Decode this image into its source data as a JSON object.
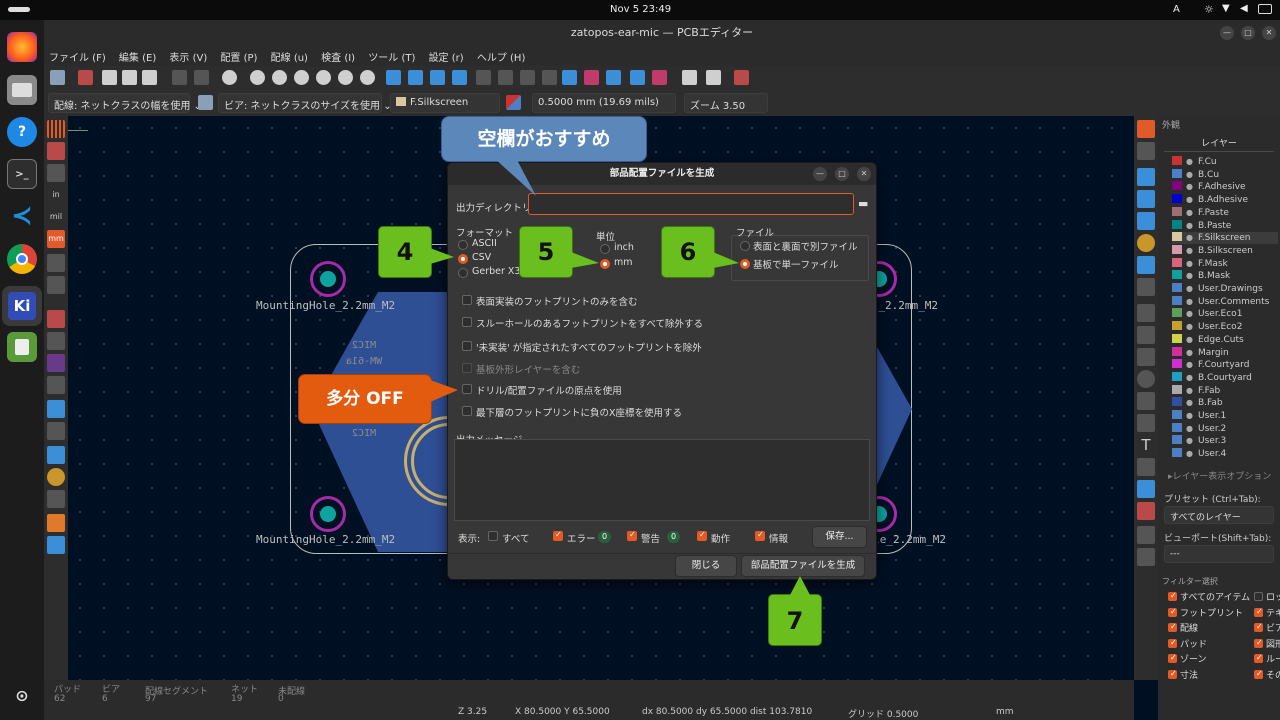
{
  "topbar": {
    "datetime": "Nov 5  23:49",
    "lang": "A"
  },
  "window": {
    "title": "zatopos-ear-mic — PCBエディター"
  },
  "menu": [
    "ファイル (F)",
    "編集 (E)",
    "表示 (V)",
    "配置 (P)",
    "配線 (u)",
    "検査 (I)",
    "ツール (T)",
    "設定 (r)",
    "ヘルプ (H)"
  ],
  "toolbar2": {
    "track_width": "配線: ネットクラスの幅を使用",
    "via_size": "ビア: ネットクラスのサイズを使用",
    "active_layer": "F.Silkscreen",
    "grid": "0.5000 mm (19.69 mils)",
    "zoom": "ズーム 3.50"
  },
  "lefttools": {
    "in": "in",
    "mil": "mil",
    "mm": "mm"
  },
  "board": {
    "ref_label": "MountingHole_2.2mm_M2",
    "mic_label": "MIC2",
    "mic_value": "WM-61a",
    "hole_ref": "REF**"
  },
  "right_panel": {
    "header": "外観",
    "tab_layers": "レイヤー",
    "layers": [
      {
        "name": "F.Cu",
        "color": "#c83434"
      },
      {
        "name": "B.Cu",
        "color": "#4d7fc4"
      },
      {
        "name": "F.Adhesive",
        "color": "#84007c"
      },
      {
        "name": "B.Adhesive",
        "color": "#0000cf"
      },
      {
        "name": "F.Paste",
        "color": "#9a7070"
      },
      {
        "name": "B.Paste",
        "color": "#008484"
      },
      {
        "name": "F.Silkscreen",
        "color": "#d8c8a0"
      },
      {
        "name": "B.Silkscreen",
        "color": "#d898b0"
      },
      {
        "name": "F.Mask",
        "color": "#d8647c"
      },
      {
        "name": "B.Mask",
        "color": "#10a0a0"
      },
      {
        "name": "User.Drawings",
        "color": "#4d7fc4"
      },
      {
        "name": "User.Comments",
        "color": "#4d7fc4"
      },
      {
        "name": "User.Eco1",
        "color": "#5aa05a"
      },
      {
        "name": "User.Eco2",
        "color": "#c4a030"
      },
      {
        "name": "Edge.Cuts",
        "color": "#d0d24a"
      },
      {
        "name": "Margin",
        "color": "#d0309c"
      },
      {
        "name": "F.Courtyard",
        "color": "#d030d0"
      },
      {
        "name": "B.Courtyard",
        "color": "#20a0c0"
      },
      {
        "name": "F.Fab",
        "color": "#aaaaaa"
      },
      {
        "name": "B.Fab",
        "color": "#3050a0"
      },
      {
        "name": "User.1",
        "color": "#4d7fc4"
      },
      {
        "name": "User.2",
        "color": "#4d7fc4"
      },
      {
        "name": "User.3",
        "color": "#4d7fc4"
      },
      {
        "name": "User.4",
        "color": "#4d7fc4"
      }
    ],
    "layer_options": "▸レイヤー表示オプション",
    "preset_label": "プリセット (Ctrl+Tab):",
    "preset_value": "すべてのレイヤー",
    "viewport_label": "ビューポート(Shift+Tab):",
    "viewport_value": "---",
    "filter_label": "フィルター選択",
    "filters_left": [
      "すべてのアイテム",
      "フットプリント",
      "配線",
      "パッド",
      "ゾーン",
      "寸法"
    ],
    "filters_right": [
      "ロッ",
      "テキ",
      "ビア",
      "図形",
      "ルー",
      "その"
    ]
  },
  "statusbar": {
    "pads_label": "パッド",
    "pads": "62",
    "vias_label": "ビア",
    "vias": "6",
    "segments_label": "配線セグメント",
    "segments": "97",
    "nets_label": "ネット",
    "nets": "19",
    "unrouted_label": "未配線",
    "unrouted": "0",
    "z": "Z 3.25",
    "xy": "X 80.5000  Y 65.5000",
    "dxy": "dx 80.5000  dy 65.5000  dist 103.7810",
    "grid": "グリッド 0.5000",
    "units": "mm"
  },
  "dialog": {
    "title": "部品配置ファイルを生成",
    "output_dir_label": "出力ディレクトリ:",
    "output_dir_value": "",
    "format_label": "フォーマット",
    "formats": [
      "ASCII",
      "CSV",
      "Gerber X3"
    ],
    "units_label": "単位",
    "units": [
      "inch",
      "mm"
    ],
    "files_label": "ファイル",
    "files": [
      "表面と裏面で別ファイル",
      "基板で単一ファイル"
    ],
    "options": [
      "表面実装のフットプリントのみを含む",
      "スルーホールのあるフットプリントをすべて除外する",
      "'未実装' が指定されたすべてのフットプリントを除外",
      "基板外形レイヤーを含む",
      "ドリル/配置ファイルの原点を使用",
      "最下層のフットプリントに負のX座標を使用する"
    ],
    "messages_label": "出力メッセージ",
    "show_label": "表示:",
    "all": "すべて",
    "errors": "エラー",
    "errors_count": "0",
    "warnings": "警告",
    "warnings_count": "0",
    "actions": "動作",
    "infos": "情報",
    "save": "保存...",
    "close": "閉じる",
    "generate": "部品配置ファイルを生成"
  },
  "annotations": {
    "blank_recommend": "空欄がおすすめ",
    "off_note": "多分 OFF",
    "n4": "4",
    "n5": "5",
    "n6": "6",
    "n7": "7"
  }
}
